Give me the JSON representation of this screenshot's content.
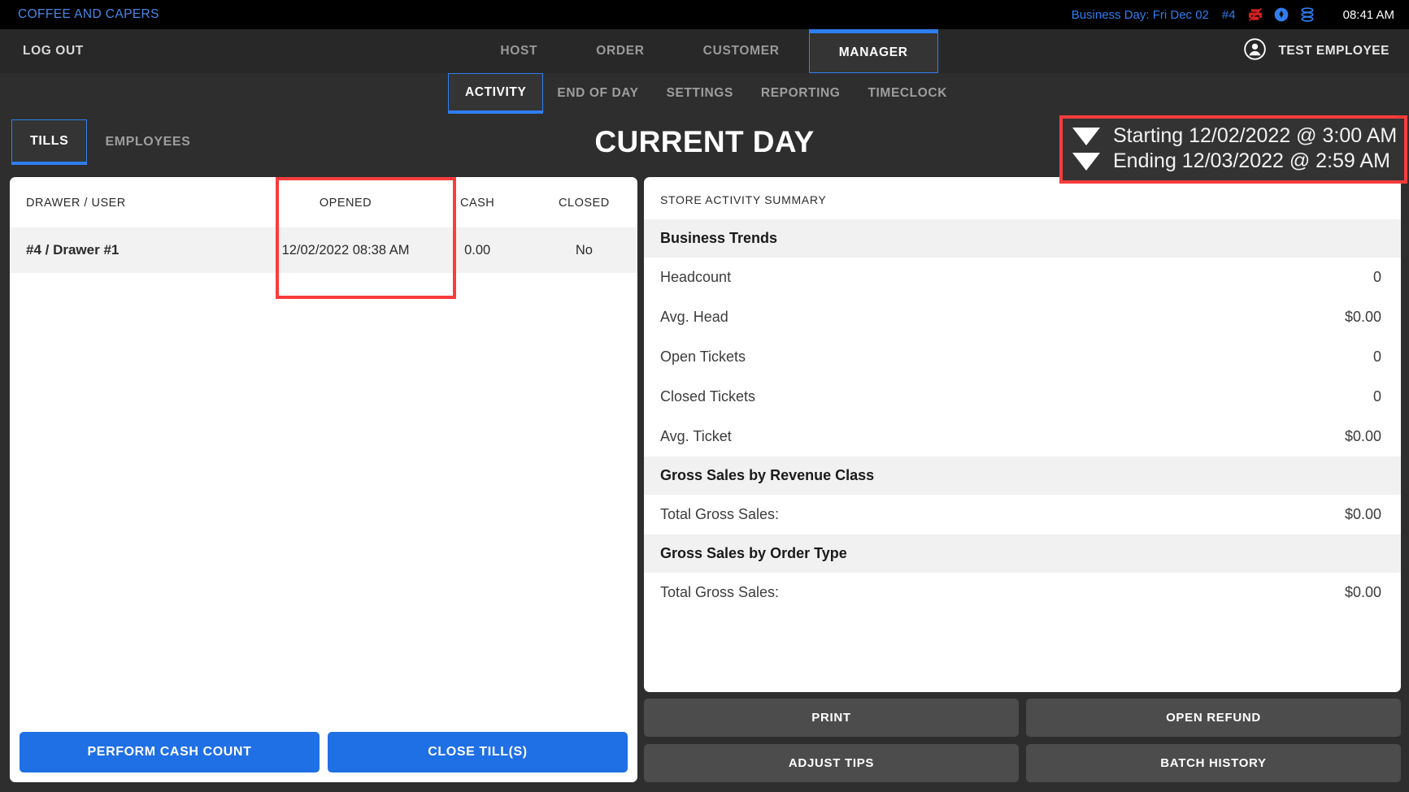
{
  "statusbar": {
    "brand": "COFFEE AND CAPERS",
    "business_day": "Business Day: Fri Dec 02",
    "drawer_number": "#4",
    "clock": "08:41 AM",
    "icons": [
      "printer-off-icon",
      "payment-device-icon",
      "database-icon"
    ],
    "accent_blue": "#2f7ef0",
    "alert_red": "#d42020"
  },
  "mainnav": {
    "logout": "LOG OUT",
    "items": [
      {
        "label": "HOST",
        "active": false
      },
      {
        "label": "ORDER",
        "active": false
      },
      {
        "label": "CUSTOMER",
        "active": false
      },
      {
        "label": "MANAGER",
        "active": true
      }
    ],
    "user_name": "TEST EMPLOYEE",
    "user_icon": "account-circle-icon"
  },
  "subnav": {
    "items": [
      {
        "label": "ACTIVITY",
        "active": true
      },
      {
        "label": "END OF DAY",
        "active": false
      },
      {
        "label": "SETTINGS",
        "active": false
      },
      {
        "label": "REPORTING",
        "active": false
      },
      {
        "label": "TIMECLOCK",
        "active": false
      }
    ]
  },
  "page": {
    "title": "CURRENT DAY",
    "tabs": [
      {
        "label": "TILLS",
        "active": true
      },
      {
        "label": "EMPLOYEES",
        "active": false
      }
    ]
  },
  "date_range": {
    "starting": "Starting 12/02/2022 @ 3:00 AM",
    "ending": "Ending 12/03/2022 @ 2:59 AM",
    "highlight_color": "#fa3c3c"
  },
  "tills_table": {
    "columns": [
      "DRAWER / USER",
      "OPENED",
      "CASH",
      "CLOSED"
    ],
    "rows": [
      {
        "drawer_user": "#4 / Drawer #1",
        "opened": "12/02/2022 08:38 AM",
        "cash": "0.00",
        "closed": "No"
      }
    ],
    "highlighted_column": "OPENED"
  },
  "left_actions": [
    {
      "label": "PERFORM CASH COUNT"
    },
    {
      "label": "CLOSE TILL(S)"
    }
  ],
  "summary": {
    "title": "STORE ACTIVITY SUMMARY",
    "rows": [
      {
        "label": "Business Trends",
        "value": "",
        "section": true
      },
      {
        "label": "Headcount",
        "value": "0",
        "section": false
      },
      {
        "label": "Avg. Head",
        "value": "$0.00",
        "section": false
      },
      {
        "label": "Open Tickets",
        "value": "0",
        "section": false
      },
      {
        "label": "Closed Tickets",
        "value": "0",
        "section": false
      },
      {
        "label": "Avg. Ticket",
        "value": "$0.00",
        "section": false
      },
      {
        "label": "Gross Sales by Revenue Class",
        "value": "",
        "section": true
      },
      {
        "label": "Total Gross Sales:",
        "value": "$0.00",
        "section": false
      },
      {
        "label": "Gross Sales by Order Type",
        "value": "",
        "section": true
      },
      {
        "label": "Total Gross Sales:",
        "value": "$0.00",
        "section": false
      }
    ]
  },
  "right_actions": [
    {
      "label": "PRINT"
    },
    {
      "label": "OPEN REFUND"
    },
    {
      "label": "ADJUST TIPS"
    },
    {
      "label": "BATCH HISTORY"
    }
  ]
}
